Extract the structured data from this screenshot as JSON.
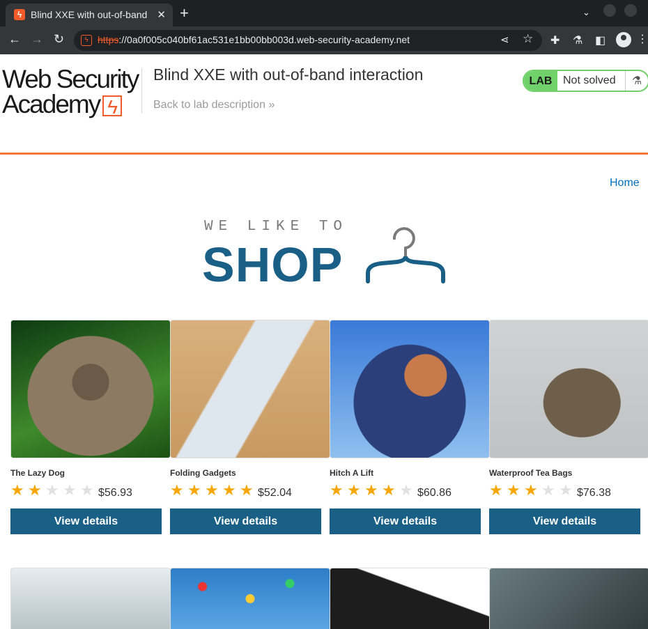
{
  "browser": {
    "tab_title": "Blind XXE with out-of-band interaction",
    "url_scheme": "https",
    "url_rest": "://0a0f005c040bf61ac531e1bb00bb003d.web-security-academy.net"
  },
  "academy": {
    "logo_line1": "Web Security",
    "logo_line2": "Academy",
    "lab_title": "Blind XXE with out-of-band interaction",
    "back_link": "Back to lab description",
    "badge_label": "LAB",
    "badge_status": "Not solved"
  },
  "nav": {
    "home": "Home"
  },
  "hero": {
    "small": "WE LIKE TO",
    "big": "SHOP"
  },
  "products": [
    {
      "name": "The Lazy Dog",
      "stars": "★★☆☆☆",
      "rating": 2,
      "price": "$56.93",
      "button": "View details"
    },
    {
      "name": "Folding Gadgets",
      "stars": "★★★★★",
      "rating": 5,
      "price": "$52.04",
      "button": "View details"
    },
    {
      "name": "Hitch A Lift",
      "stars": "★★★★☆",
      "rating": 4,
      "price": "$60.86",
      "button": "View details"
    },
    {
      "name": "Waterproof Tea Bags",
      "stars": "★★★☆☆",
      "rating": 3,
      "price": "$76.38",
      "button": "View details"
    }
  ],
  "colors": {
    "accent": "#f0793a",
    "button": "#1a5f86",
    "star_on": "#f7a707",
    "star_off": "#e1e1e1",
    "badge_green": "#70d16a",
    "link": "#0071bc"
  }
}
